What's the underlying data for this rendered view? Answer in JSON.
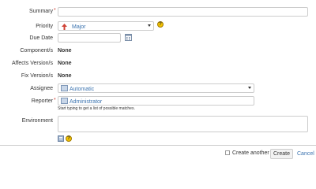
{
  "fields": {
    "summary": {
      "label": "Summary",
      "required": "*",
      "value": ""
    },
    "priority": {
      "label": "Priority",
      "value": "Major"
    },
    "due_date": {
      "label": "Due Date",
      "value": ""
    },
    "components": {
      "label": "Component/s",
      "value": "None"
    },
    "affects_versions": {
      "label": "Affects Version/s",
      "value": "None"
    },
    "fix_versions": {
      "label": "Fix Version/s",
      "value": "None"
    },
    "assignee": {
      "label": "Assignee",
      "value": "Automatic"
    },
    "reporter": {
      "label": "Reporter",
      "required": "*",
      "value": "Administrator",
      "hint": "Start typing to get a list of possible matches."
    },
    "environment": {
      "label": "Environment",
      "value": ""
    }
  },
  "icons": {
    "priority": "priority-major-arrow-icon",
    "help": "question-mark-icon",
    "calendar": "calendar-icon",
    "user": "user-avatar-icon",
    "wiki": "wiki-markup-icon"
  },
  "help_glyph": "?",
  "footer": {
    "create_another_label": "Create another",
    "create_another_checked": false,
    "create_button": "Create",
    "cancel_link": "Cancel"
  },
  "colors": {
    "link": "#3b73af",
    "required": "#d04437",
    "priority_major": "#d04437",
    "help": "#f5c400"
  }
}
